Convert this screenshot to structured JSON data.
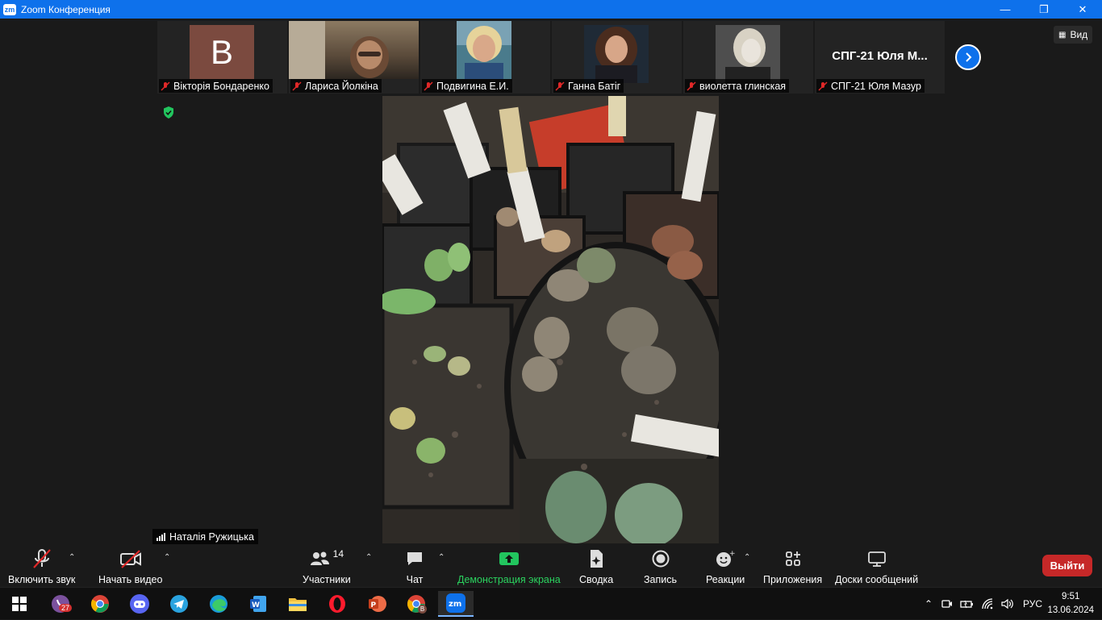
{
  "window": {
    "title": "Zoom Конференция",
    "logo_text": "zm"
  },
  "participants": [
    {
      "name": "Вікторія Бондаренко",
      "avatar_letter": "B",
      "muted": true
    },
    {
      "name": "Лариса Йолкіна",
      "muted": true
    },
    {
      "name": "Подвигина Е.И.",
      "muted": true
    },
    {
      "name": "Ганна Батіг",
      "muted": true
    },
    {
      "name": "виолетта глинская",
      "muted": true
    },
    {
      "name": "СПГ-21 Юля Мазур",
      "display_title": "СПГ-21 Юля М...",
      "muted": true
    }
  ],
  "view_button": {
    "label": "Вид"
  },
  "active_speaker": {
    "name": "Наталія Ружицька"
  },
  "toolbar": {
    "audio": "Включить звук",
    "video": "Начать видео",
    "participants": "Участники",
    "participants_count": "14",
    "chat": "Чат",
    "share": "Демонстрация экрана",
    "summary": "Сводка",
    "record": "Запись",
    "reactions": "Реакции",
    "apps": "Приложения",
    "whiteboards": "Доски сообщений",
    "leave": "Выйти"
  },
  "taskbar": {
    "viber_badge": "27",
    "chrome_profile": "B",
    "language": "РУС",
    "time": "9:51",
    "date": "13.06.2024"
  },
  "colors": {
    "zoom_blue": "#0e71eb",
    "share_green": "#2bd35f",
    "leave_red": "#c62828",
    "muted_red": "#e02828"
  }
}
